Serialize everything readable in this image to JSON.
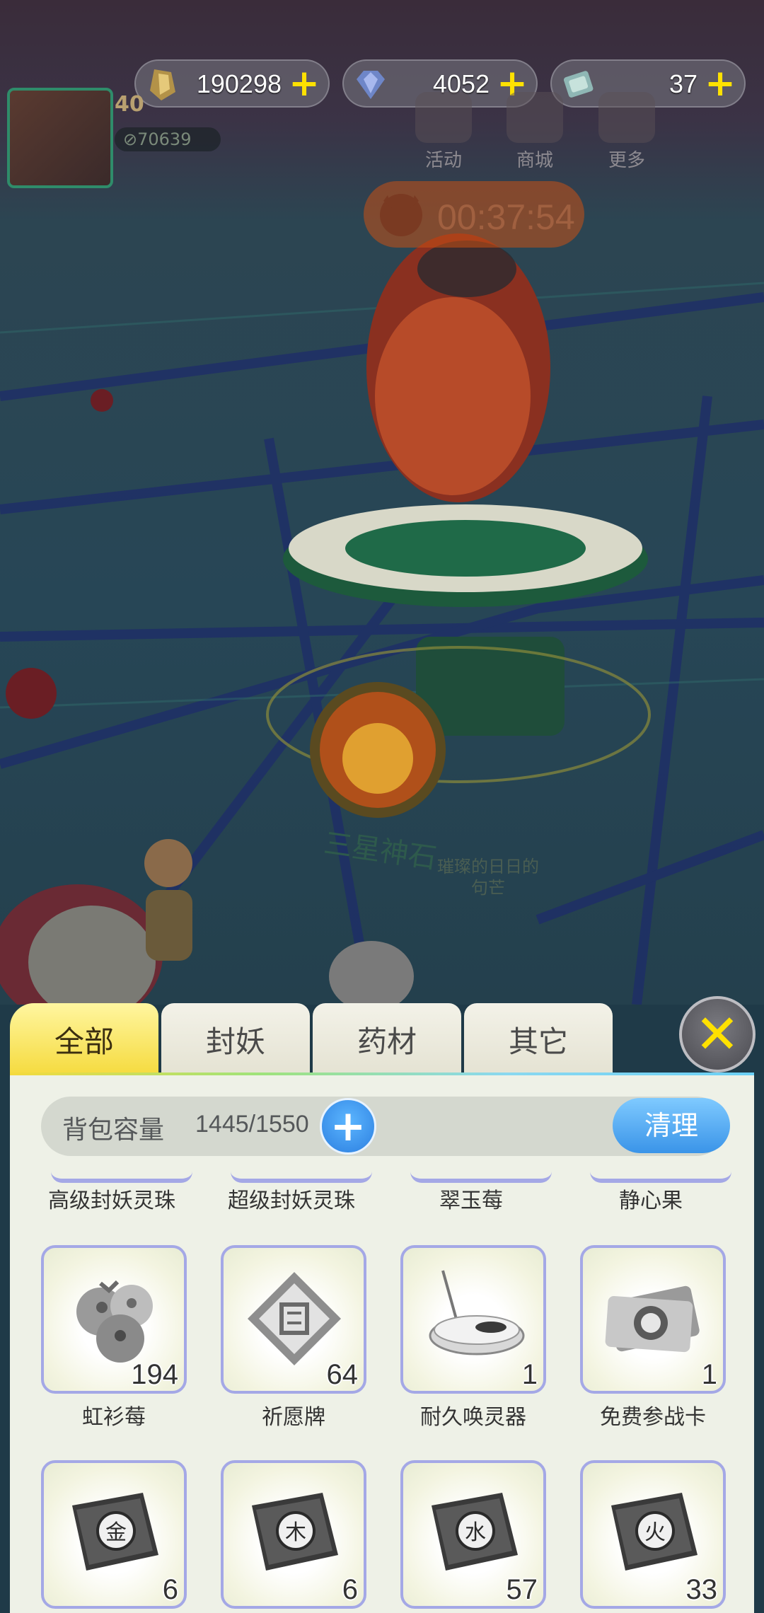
{
  "resources": [
    {
      "icon": "gold-crystal-icon",
      "value": "190298"
    },
    {
      "icon": "diamond-icon",
      "value": "4052"
    },
    {
      "icon": "ticket-icon",
      "value": "37"
    }
  ],
  "resource_plus": "+",
  "player": {
    "level": "40",
    "power": "⊘70639"
  },
  "top_menu": [
    {
      "icon": "gift-icon",
      "label": "活动"
    },
    {
      "icon": "shop-icon",
      "label": "商城"
    },
    {
      "icon": "grid-icon",
      "label": "更多"
    }
  ],
  "event_timer": "00:37:54",
  "poi": {
    "name": "三星神石",
    "sub_line1": "璀璨的日日的",
    "sub_line2": "句芒"
  },
  "tabs": [
    "全部",
    "封妖",
    "药材",
    "其它"
  ],
  "close_symbol": "✕",
  "bag": {
    "capacity_label": "背包容量",
    "capacity_value": "1445/1550",
    "expand_symbol": "+",
    "clean_label": "清理"
  },
  "partial_row": [
    "高级封妖灵珠",
    "超级封妖灵珠",
    "翠玉莓",
    "静心果"
  ],
  "items": [
    {
      "name": "虹衫莓",
      "count": "194",
      "icon": "berry-icon"
    },
    {
      "name": "祈愿牌",
      "count": "64",
      "icon": "wish-plaque-icon"
    },
    {
      "name": "耐久唤灵器",
      "count": "1",
      "icon": "summoner-device-icon"
    },
    {
      "name": "免费参战卡",
      "count": "1",
      "icon": "battle-ticket-icon"
    },
    {
      "name": "",
      "count": "6",
      "icon": "metal-book-icon",
      "glyph": "金"
    },
    {
      "name": "",
      "count": "6",
      "icon": "wood-book-icon",
      "glyph": "木"
    },
    {
      "name": "",
      "count": "57",
      "icon": "water-book-icon",
      "glyph": "水"
    },
    {
      "name": "",
      "count": "33",
      "icon": "fire-book-icon",
      "glyph": "火"
    }
  ],
  "colors": {
    "accent_yellow": "#f5da3c",
    "accent_blue": "#3a94e8",
    "slot_border": "#a4a8e6"
  }
}
